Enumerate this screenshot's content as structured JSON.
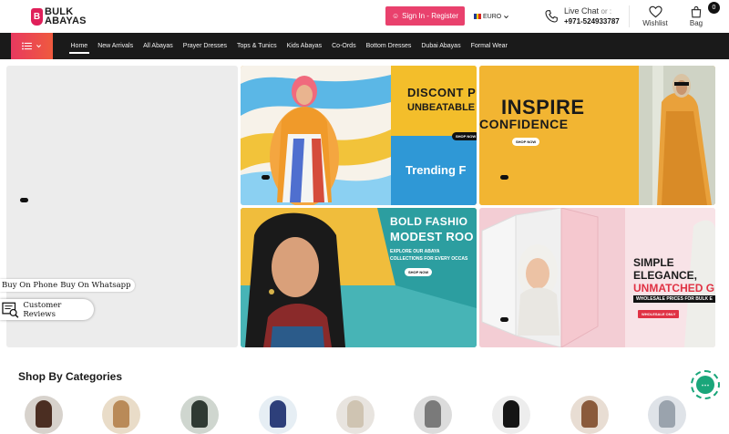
{
  "header": {
    "logo_line1": "BULK",
    "logo_line2": "ABAYAS",
    "signin_label": "Sign In - Register",
    "currency": "EURO",
    "live_chat_label": "Live Chat",
    "live_chat_suffix": "or :",
    "phone": "+971-524933787",
    "wishlist_label": "Wishlist",
    "bag_label": "Bag",
    "bag_count": "0",
    "accent_color": "#e9416d"
  },
  "nav": {
    "items": [
      {
        "label": "Home",
        "active": true
      },
      {
        "label": "New Arrivals"
      },
      {
        "label": "All Abayas"
      },
      {
        "label": "Prayer Dresses"
      },
      {
        "label": "Tops & Tunics"
      },
      {
        "label": "Kids Abayas"
      },
      {
        "label": "Co-Ords"
      },
      {
        "label": "Bottom Dresses"
      },
      {
        "label": "Dubai Abayas"
      },
      {
        "label": "Formal Wear"
      }
    ]
  },
  "banners": {
    "b1": {
      "line1": "DISCONT P",
      "line2": "UNBEATABLE",
      "line3": "Trending F",
      "button": "SHOP NOW"
    },
    "b2": {
      "line1": "INSPIRE",
      "line2": "CONFIDENCE",
      "button": "SHOP NOW"
    },
    "b3": {
      "line1": "BOLD FASHIO",
      "line2": "MODEST ROO",
      "line3": "EXPLORE OUR ABAYA",
      "line4": "COLLECTIONS FOR EVERY OCCAS",
      "button": "SHOP NOW"
    },
    "b4": {
      "line1": "SIMPLE",
      "line2": "ELEGANCE,",
      "line3": "UNMATCHED G",
      "line4": "WHOLESALE PRICES FOR BULK E",
      "button": "WHOLESALE ONLY"
    }
  },
  "floating": {
    "phone_label": "Buy On Phone",
    "whatsapp_label": "Buy On Whatsapp",
    "reviews_label": "Customer Reviews"
  },
  "categories": {
    "title": "Shop By Categories"
  }
}
